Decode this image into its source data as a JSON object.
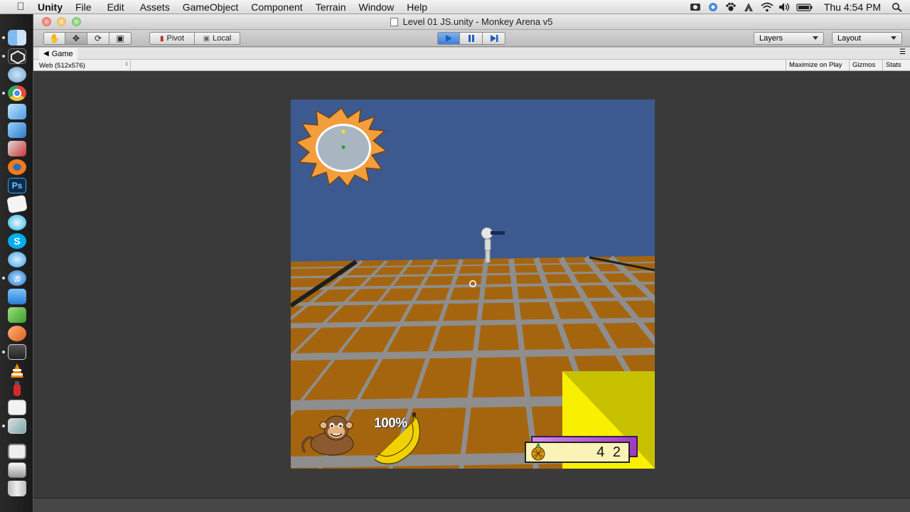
{
  "menubar": {
    "app_name": "Unity",
    "menus": [
      "File",
      "Edit",
      "Assets",
      "GameObject",
      "Component",
      "Terrain",
      "Window",
      "Help"
    ],
    "clock": "Thu 4:54 PM"
  },
  "window": {
    "title": "Level 01 JS.unity - Monkey Arena v5"
  },
  "toolbar": {
    "pivot_label": "Pivot",
    "local_label": "Local",
    "layers_label": "Layers",
    "layout_label": "Layout"
  },
  "game_tab": {
    "label": "Game",
    "resolution": "Web (512x576)",
    "maximize_label": "Maximize on Play",
    "gizmos_label": "Gizmos",
    "stats_label": "Stats"
  },
  "hud": {
    "health_percent": "100%",
    "score": "4 2"
  },
  "colors": {
    "sky": "#3c5a8f",
    "floor_tile": "#a5650f",
    "grid_line": "#8e8e8e",
    "hud_yellow": "#c8c100",
    "radar_orange": "#f29e3c"
  },
  "dock_icons": [
    "finder-icon",
    "unity-icon",
    "sync-icon",
    "chrome-icon",
    "cube-icon",
    "preview-icon",
    "tools-icon",
    "blender-icon",
    "photoshop-icon",
    "paper-icon",
    "aqua-icon",
    "skype-icon",
    "messages-icon",
    "itunes-icon",
    "app-icon",
    "puzzle-icon",
    "hook-icon",
    "clapper-icon",
    "vlc-icon",
    "extinguisher-icon",
    "pen-icon",
    "photos-icon",
    "window-icon",
    "files-icon",
    "trash-icon"
  ]
}
